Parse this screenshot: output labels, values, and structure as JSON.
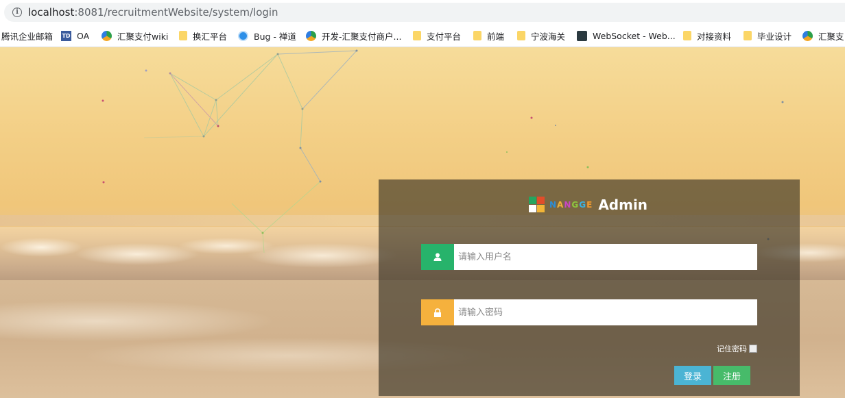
{
  "browser": {
    "url_host": "localhost",
    "url_rest": ":8081/recruitmentWebsite/system/login"
  },
  "bookmarks": [
    {
      "label": "腾讯企业邮箱",
      "icon": "none"
    },
    {
      "label": "OA",
      "icon": "td-icon"
    },
    {
      "label": "汇聚支付wiki",
      "icon": "triangle-logo-icon"
    },
    {
      "label": "换汇平台",
      "icon": "folder-icon"
    },
    {
      "label": "Bug - 禅道",
      "icon": "bug-icon"
    },
    {
      "label": "开发-汇聚支付商户...",
      "icon": "triangle-logo-icon"
    },
    {
      "label": "支付平台",
      "icon": "folder-icon"
    },
    {
      "label": "前端",
      "icon": "folder-icon"
    },
    {
      "label": "宁波海关",
      "icon": "folder-icon"
    },
    {
      "label": "WebSocket - Web...",
      "icon": "websocket-icon"
    },
    {
      "label": "对接资料",
      "icon": "folder-icon"
    },
    {
      "label": "毕业设计",
      "icon": "folder-icon"
    },
    {
      "label": "汇聚支",
      "icon": "triangle-logo-icon"
    }
  ],
  "login": {
    "brand": "NANGGE",
    "brand_letters": [
      {
        "ch": "N",
        "color": "#2c8dd6"
      },
      {
        "ch": "A",
        "color": "#f0b23b"
      },
      {
        "ch": "N",
        "color": "#c846c4"
      },
      {
        "ch": "G",
        "color": "#8dc63f"
      },
      {
        "ch": "G",
        "color": "#3bb1e0"
      },
      {
        "ch": "E",
        "color": "#f09a2e"
      }
    ],
    "admin_label": "Admin",
    "username_placeholder": "请输入用户名",
    "password_placeholder": "请输入密码",
    "remember_label": "记住密码",
    "login_button": "登录",
    "register_button": "注册"
  },
  "colors": {
    "user_addon": "#27b36b",
    "lock_addon": "#f5b13d",
    "login_button": "#4bb4d4",
    "register_button": "#47bb6a",
    "logo_tl": "#25a55f",
    "logo_tr": "#e14d2a",
    "logo_bl": "#ffffff",
    "logo_br": "#f2b537"
  }
}
